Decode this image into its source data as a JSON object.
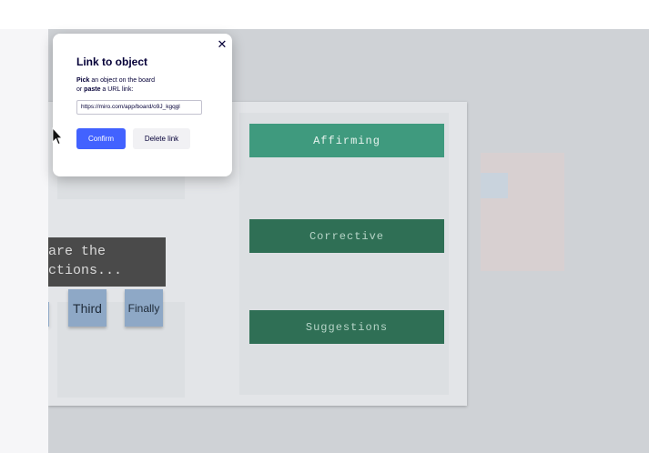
{
  "board": {
    "labels": {
      "affirming": "Affirming",
      "corrective": "Corrective",
      "suggestions": "Suggestions"
    },
    "dark_note_text": "are the\nctions...",
    "stickies": {
      "third": "Third",
      "finally": "Finally"
    }
  },
  "dialog": {
    "title": "Link to object",
    "instruction_pick": "Pick",
    "instruction_line1_rest": " an object on the board",
    "instruction_or": "or ",
    "instruction_paste": "paste",
    "instruction_line2_rest": " a URL link:",
    "url_value": "https://miro.com/app/board/o9J_kgqgl",
    "confirm_label": "Confirm",
    "delete_label": "Delete link",
    "close_glyph": "✕"
  },
  "colors": {
    "confirm_bg": "#4262ff",
    "affirming_bg": "#3f9a7e",
    "corrective_bg": "#2f6f55"
  }
}
